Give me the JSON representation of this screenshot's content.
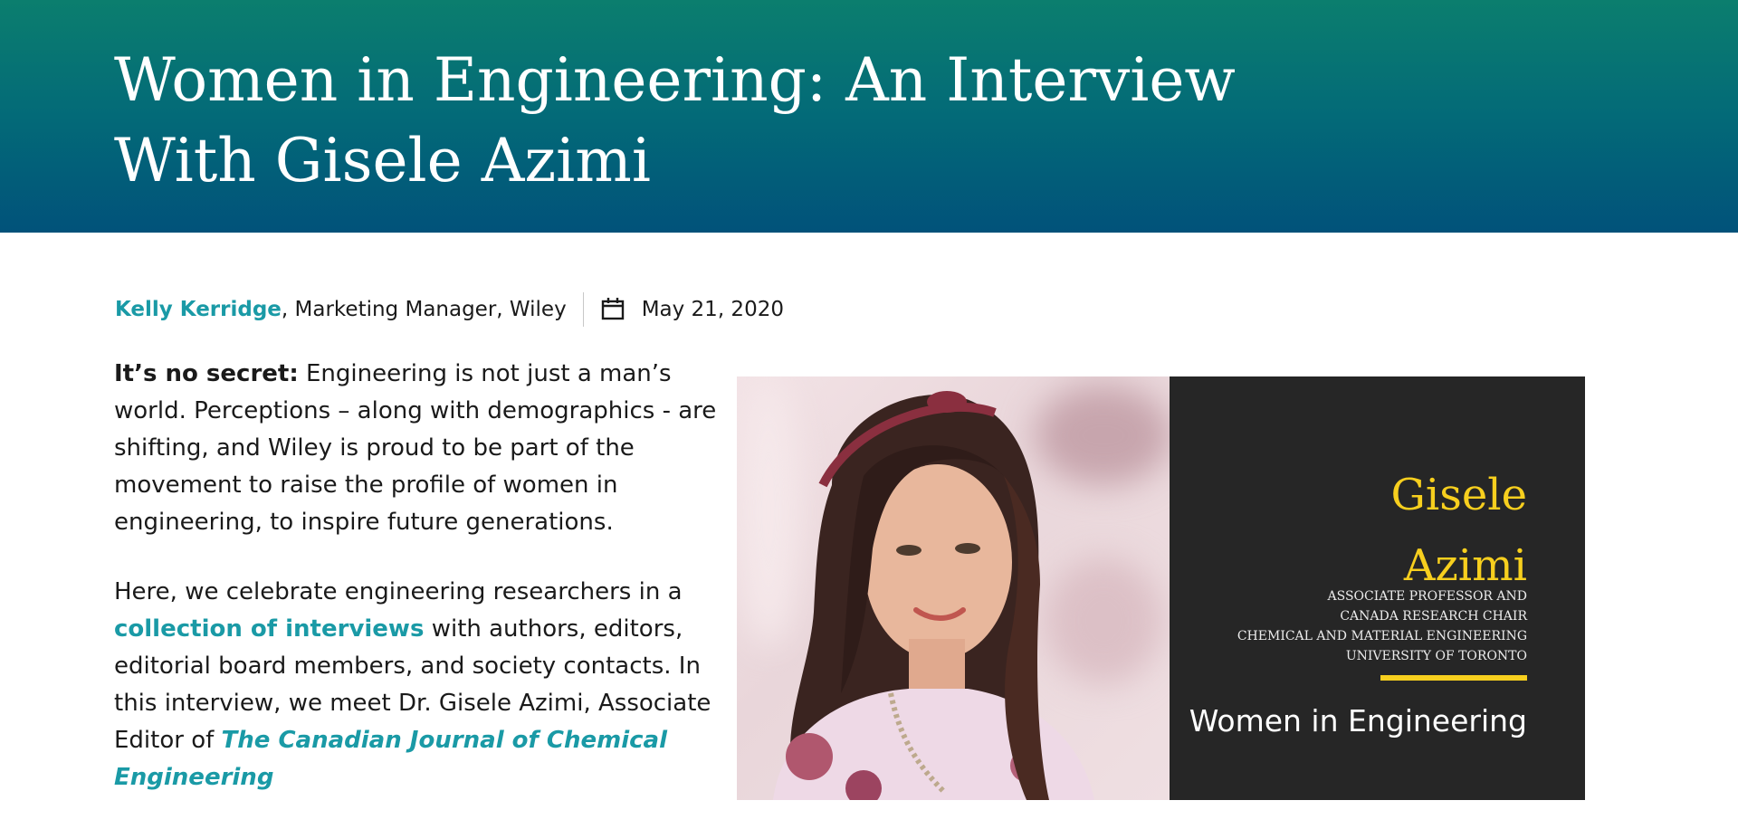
{
  "header": {
    "title": "Women in Engineering: An Interview With Gisele Azimi"
  },
  "byline": {
    "author": "Kelly Kerridge",
    "author_role": ", Marketing Manager, Wiley",
    "date": "May 21, 2020",
    "date_icon": "calendar-icon"
  },
  "intro": {
    "lead_bold": "It’s no secret:",
    "lead_rest": " Engineering is not just a man’s world. Perceptions – along with demographics - are shifting, and Wiley is proud to be part of the movement to raise the profile of women in engineering, to inspire future generations.",
    "p2_before": "Here, we celebrate engineering researchers in a ",
    "p2_link": "collection of interviews",
    "p2_middle": " with authors, editors, editorial board members, and society contacts. In this interview, we meet Dr. Gisele Azimi, Associate Editor of ",
    "p2_journal": "The Canadian Journal of Chemical Engineering"
  },
  "feature_image": {
    "name_line1": "Gisele",
    "name_line2": "Azimi",
    "titles": [
      "Associate Professor and",
      "Canada Research Chair",
      "Chemical and Material Engineering",
      "University of Toronto"
    ],
    "tagline": "Women in Engineering"
  },
  "colors": {
    "accent": "#1a9aa6",
    "header_gradient_top": "#0b7e6e",
    "header_gradient_bottom": "#01527a",
    "panel_bg": "#262626",
    "panel_highlight": "#f7cf1e"
  }
}
